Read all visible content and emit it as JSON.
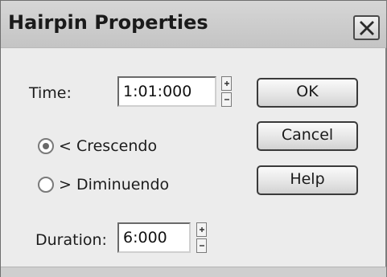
{
  "window": {
    "title": "Hairpin Properties"
  },
  "time": {
    "label": "Time:",
    "value": "1:01:000"
  },
  "hairpin_type": {
    "options": [
      {
        "label": "< Crescendo",
        "selected": true
      },
      {
        "label": "> Diminuendo",
        "selected": false
      }
    ]
  },
  "duration": {
    "label": "Duration:",
    "value": "6:000"
  },
  "buttons": {
    "ok": "OK",
    "cancel": "Cancel",
    "help": "Help"
  },
  "icons": {
    "close": "close-icon",
    "spin_up": "arrow-up-icon",
    "spin_down": "arrow-down-icon"
  }
}
